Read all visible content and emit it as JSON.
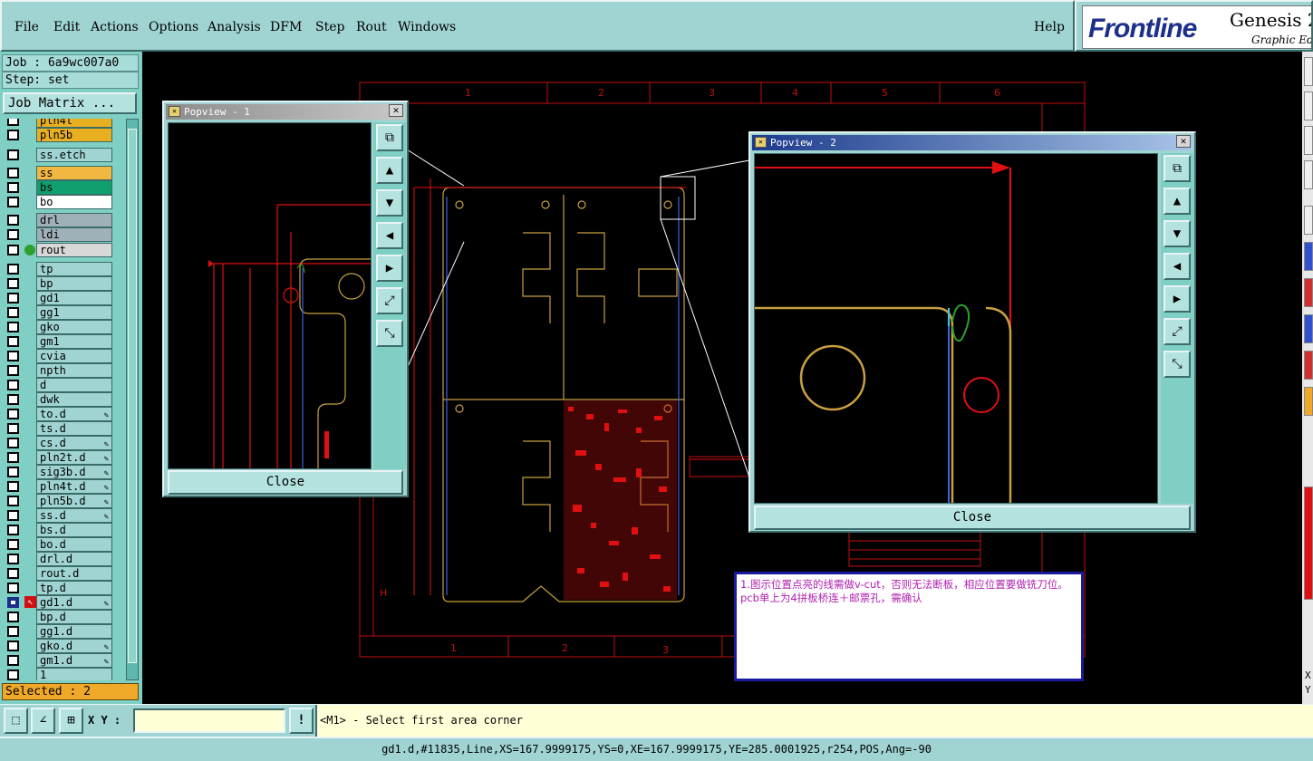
{
  "menu": {
    "items": [
      "File",
      "Edit",
      "Actions",
      "Options",
      "Analysis",
      "DFM",
      "Step",
      "Rout",
      "Windows"
    ],
    "help": "Help"
  },
  "brand": {
    "logo": "Frontline",
    "product": "Genesis 2",
    "subtitle": "Graphic Edi"
  },
  "job": {
    "job_line": "Job : 6a9wc007a0",
    "step_line": "Step: set",
    "matrix_button": "Job Matrix ..."
  },
  "layers": [
    {
      "name": "pln4t",
      "color": "#e8b020",
      "edit": false
    },
    {
      "name": "pln5b",
      "color": "#e8b020",
      "edit": false
    },
    {
      "name": "ss.etch",
      "color": "#9fd4d2",
      "edit": false
    },
    {
      "name": "ss",
      "color": "#f0b840",
      "edit": false
    },
    {
      "name": "bs",
      "color": "#10a070",
      "edit": false
    },
    {
      "name": "bo",
      "color": "#ffffff",
      "edit": false
    },
    {
      "name": "drl",
      "color": "#a0b0b8",
      "edit": false
    },
    {
      "name": "ldi",
      "color": "#a0b0b8",
      "edit": false
    },
    {
      "name": "rout",
      "color": "#d8d8d8",
      "edit": false,
      "active_dot": true
    },
    {
      "name": "tp",
      "color": "#9fd4d2",
      "edit": false
    },
    {
      "name": "bp",
      "color": "#9fd4d2",
      "edit": false
    },
    {
      "name": "gd1",
      "color": "#9fd4d2",
      "edit": false
    },
    {
      "name": "gg1",
      "color": "#9fd4d2",
      "edit": false
    },
    {
      "name": "gko",
      "color": "#9fd4d2",
      "edit": false
    },
    {
      "name": "gm1",
      "color": "#9fd4d2",
      "edit": false
    },
    {
      "name": "cvia",
      "color": "#9fd4d2",
      "edit": false
    },
    {
      "name": "npth",
      "color": "#9fd4d2",
      "edit": false
    },
    {
      "name": "d",
      "color": "#9fd4d2",
      "edit": false
    },
    {
      "name": "dwk",
      "color": "#9fd4d2",
      "edit": false
    },
    {
      "name": "to.d",
      "color": "#9fd4d2",
      "edit": true
    },
    {
      "name": "ts.d",
      "color": "#9fd4d2",
      "edit": false
    },
    {
      "name": "cs.d",
      "color": "#9fd4d2",
      "edit": true
    },
    {
      "name": "pln2t.d",
      "color": "#9fd4d2",
      "edit": true
    },
    {
      "name": "sig3b.d",
      "color": "#9fd4d2",
      "edit": true
    },
    {
      "name": "pln4t.d",
      "color": "#9fd4d2",
      "edit": true
    },
    {
      "name": "pln5b.d",
      "color": "#9fd4d2",
      "edit": true
    },
    {
      "name": "ss.d",
      "color": "#9fd4d2",
      "edit": true
    },
    {
      "name": "bs.d",
      "color": "#9fd4d2",
      "edit": false
    },
    {
      "name": "bo.d",
      "color": "#9fd4d2",
      "edit": false
    },
    {
      "name": "drl.d",
      "color": "#9fd4d2",
      "edit": false
    },
    {
      "name": "rout.d",
      "color": "#9fd4d2",
      "edit": false
    },
    {
      "name": "tp.d",
      "color": "#9fd4d2",
      "edit": false
    },
    {
      "name": "gd1.d",
      "color": "#9fd4d2",
      "edit": true,
      "selected": true
    },
    {
      "name": "bp.d",
      "color": "#9fd4d2",
      "edit": false
    },
    {
      "name": "gg1.d",
      "color": "#9fd4d2",
      "edit": false
    },
    {
      "name": "gko.d",
      "color": "#9fd4d2",
      "edit": true
    },
    {
      "name": "gm1.d",
      "color": "#9fd4d2",
      "edit": true
    },
    {
      "name": "1",
      "color": "#9fd4d2",
      "edit": false
    }
  ],
  "selected_text": "Selected : 2",
  "popups": {
    "p1": {
      "title": "Popview - 1",
      "close": "Close"
    },
    "p2": {
      "title": "Popview - 2",
      "close": "Close"
    }
  },
  "frame": {
    "top_cols": [
      "1",
      "2",
      "3",
      "4",
      "5",
      "6"
    ],
    "bottom_cols": [
      "1",
      "2",
      "3"
    ],
    "side_label": "H"
  },
  "note": "1.图示位置点亮的线需做v-cut，否则无法断板，相应位置要做铣刀位。pcb单上为4拼板桥连＋邮票孔，需确认",
  "bottom": {
    "xy_label": "X Y :",
    "xy_value": "",
    "prompt": "<M1> - Select first area corner",
    "right_x": "X",
    "right_y": "Y"
  },
  "status": "gd1.d,#11835,Line,XS=167.9999175,YS=0,XE=167.9999175,YE=285.0001925,r254,POS,Ang=-90",
  "colors": {
    "panel": "#9fd4d2",
    "board_outline": "#c8a040",
    "highlight": "#e01010",
    "vcut": "#4060e0"
  }
}
